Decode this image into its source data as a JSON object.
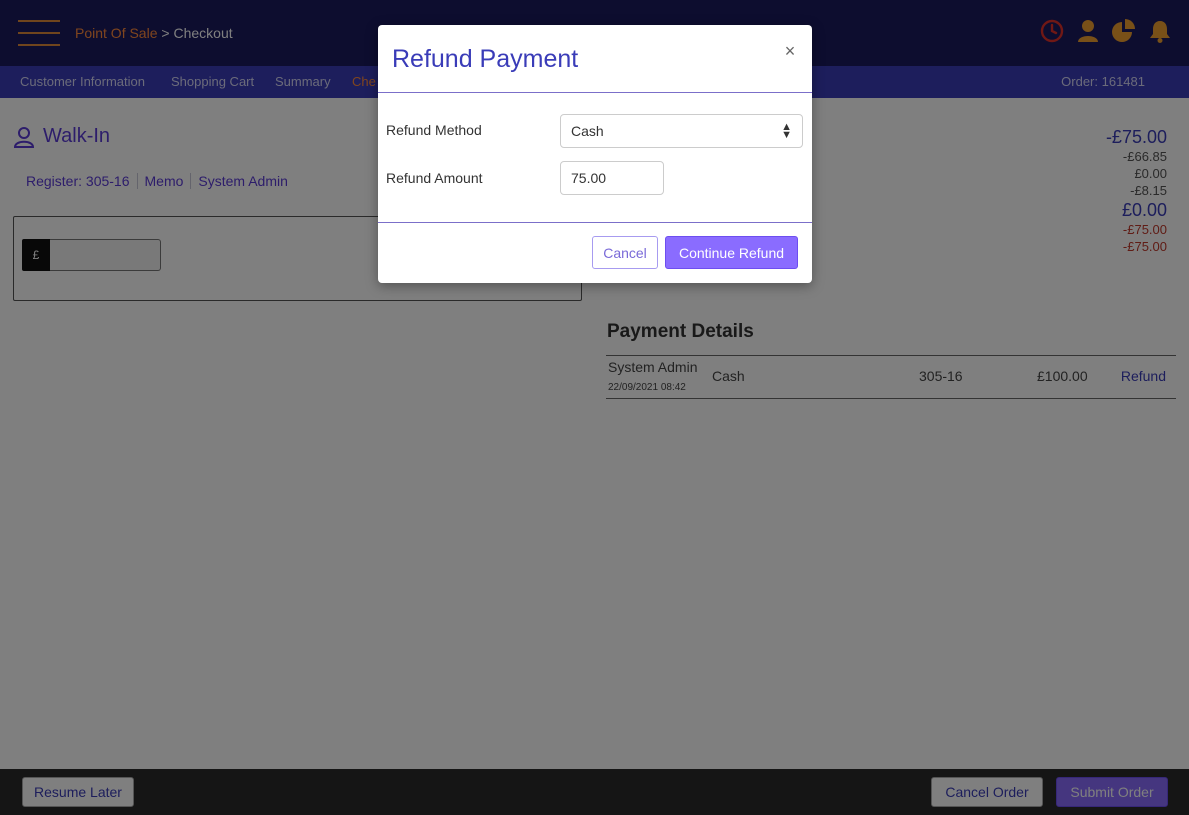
{
  "header": {
    "breadcrumb_root": "Point Of Sale",
    "breadcrumb_sep": " > ",
    "breadcrumb_current": "Checkout",
    "icons": [
      "clock-icon",
      "user-icon",
      "pie-chart-icon",
      "bell-icon"
    ],
    "icon_color_clock": "#e0302a",
    "icon_color_other": "#f0a030"
  },
  "subnav": {
    "items": [
      "Customer Information",
      "Shopping Cart",
      "Summary",
      "Che"
    ],
    "order_label": "Order: 161481"
  },
  "customer": {
    "name": "Walk-In",
    "register": "Register: 305-16",
    "memo": "Memo",
    "user": "System Admin"
  },
  "payment_entry": {
    "currency_prefix": "£",
    "amount_value": ""
  },
  "totals": {
    "balance": "-£75.00",
    "line1": "-£66.85",
    "line2": "£0.00",
    "line3": "-£8.15",
    "paid": "£0.00",
    "due1": "-£75.00",
    "due2": "-£75.00"
  },
  "payment_details": {
    "title": "Payment Details",
    "rows": [
      {
        "user": "System Admin",
        "date": "22/09/2021 08:42",
        "method": "Cash",
        "register": "305-16",
        "amount": "£100.00",
        "action": "Refund"
      }
    ]
  },
  "footer": {
    "resume_label": "Resume Later",
    "cancel_label": "Cancel Order",
    "submit_label": "Submit Order"
  },
  "modal": {
    "title": "Refund Payment",
    "close_glyph": "×",
    "method_label": "Refund Method",
    "method_value": "Cash",
    "amount_label": "Refund Amount",
    "amount_value": "75.00",
    "cancel_label": "Cancel",
    "continue_label": "Continue Refund"
  }
}
